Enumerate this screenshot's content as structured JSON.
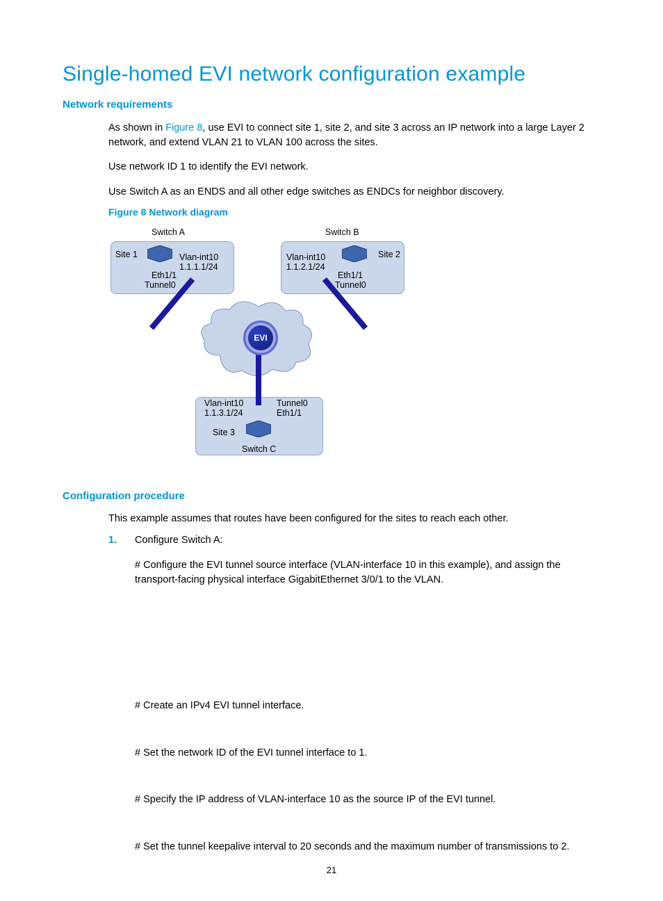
{
  "title": "Single-homed EVI network configuration example",
  "sections": {
    "net_req_heading": "Network requirements",
    "para1_pre": "As shown in ",
    "para1_link": "Figure 8",
    "para1_post": ", use EVI to connect site 1, site 2, and site 3 across an IP network into a large Layer 2 network, and extend VLAN 21 to VLAN 100 across the sites.",
    "para2": "Use network ID 1 to identify the EVI network.",
    "para3": "Use Switch A as an ENDS and all other edge switches as ENDCs for neighbor discovery.",
    "fig_caption": "Figure 8 Network diagram",
    "conf_heading": "Configuration procedure",
    "conf_intro": "This example assumes that routes have been configured for the sites to reach each other.",
    "step_num": "1.",
    "step_label": "Configure Switch A:",
    "step_a": "# Configure the EVI tunnel source interface (VLAN-interface 10 in this example), and assign the transport-facing physical interface GigabitEthernet 3/0/1 to the VLAN.",
    "step_b": "# Create an IPv4 EVI tunnel interface.",
    "step_c": "# Set the network ID of the EVI tunnel interface to 1.",
    "step_d": "# Specify the IP address of VLAN-interface 10 as the source IP of the EVI tunnel.",
    "step_e": "# Set the tunnel keepalive interval to 20 seconds and the maximum number of transmissions to 2."
  },
  "diagram": {
    "switchA": "Switch A",
    "switchB": "Switch B",
    "switchC": "Switch C",
    "site1": "Site 1",
    "site2": "Site 2",
    "site3": "Site 3",
    "vlan_a_1": "Vlan-int10",
    "vlan_a_2": "1.1.1.1/24",
    "vlan_b_1": "Vlan-int10",
    "vlan_b_2": "1.1.2.1/24",
    "vlan_c_1": "Vlan-int10",
    "vlan_c_2": "1.1.3.1/24",
    "eth_a": "Eth1/1",
    "eth_b": "Eth1/1",
    "eth_c": "Eth1/1",
    "tun_a": "Tunnel0",
    "tun_b": "Tunnel0",
    "tun_c": "Tunnel0",
    "evi": "EVI"
  },
  "page_number": "21"
}
